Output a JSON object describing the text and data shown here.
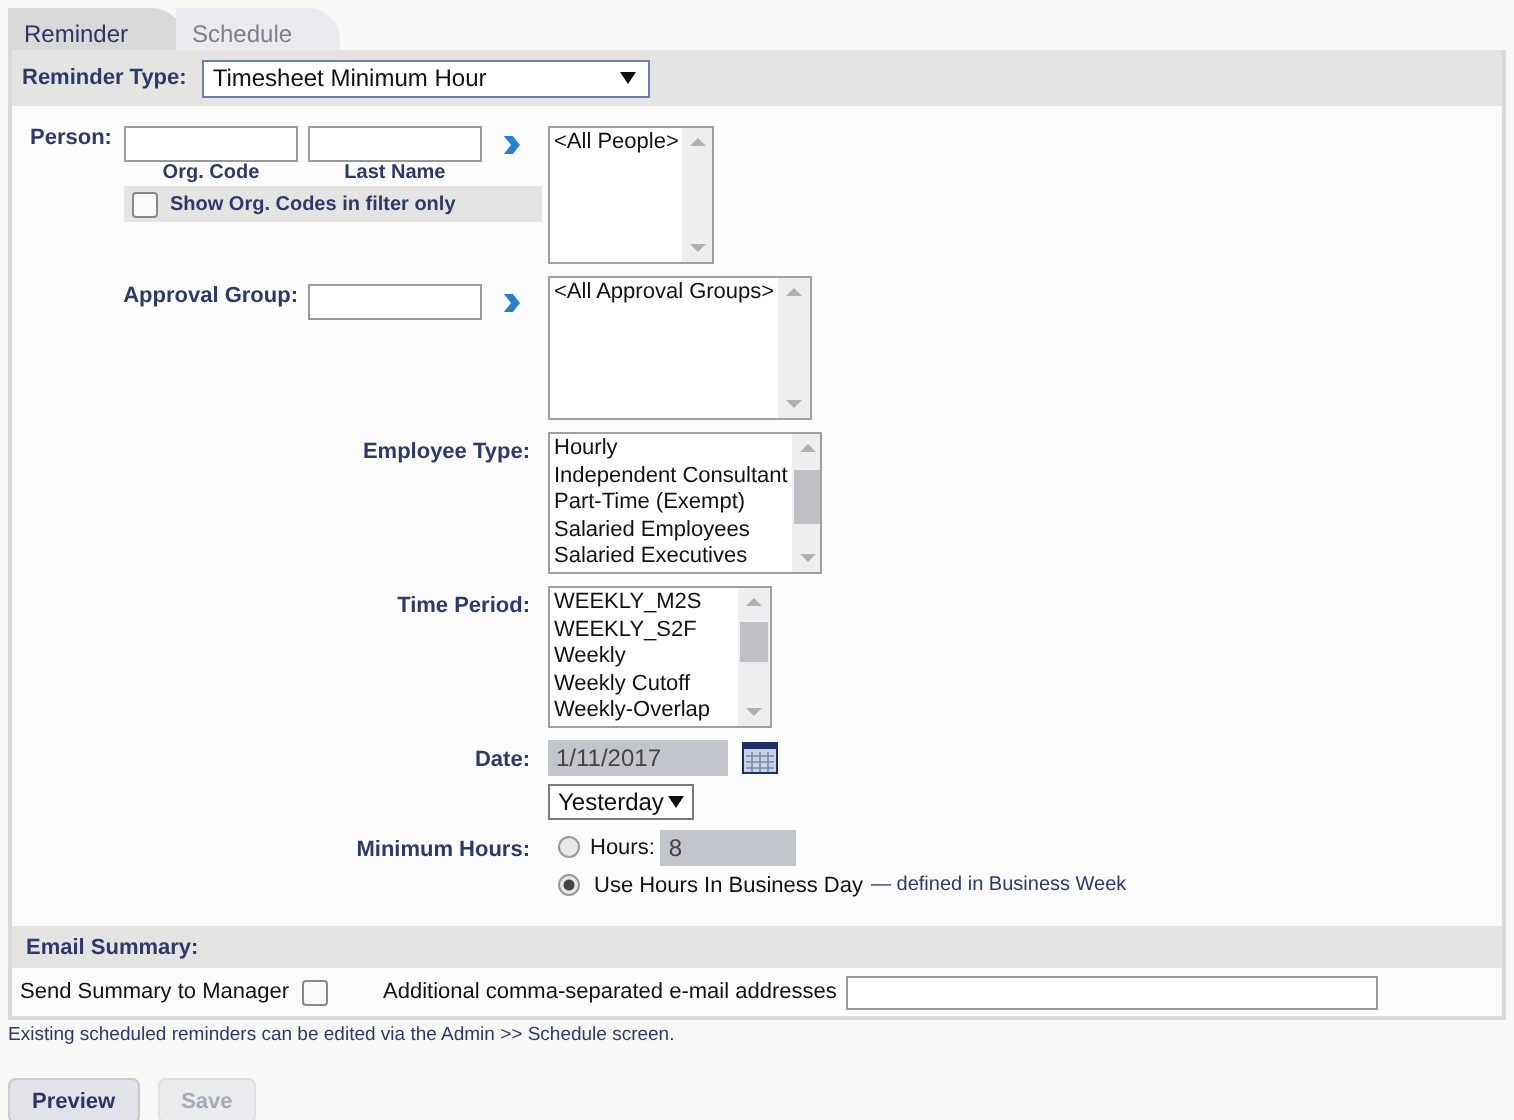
{
  "tabs": [
    {
      "label": "Reminder",
      "selected": true
    },
    {
      "label": "Schedule",
      "selected": false
    }
  ],
  "reminder_type": {
    "label": "Reminder Type:",
    "value": "Timesheet Minimum Hour"
  },
  "person": {
    "label": "Person:",
    "org_code_label": "Org. Code",
    "last_name_label": "Last Name",
    "show_org_codes": {
      "label": "Show Org. Codes in filter only",
      "checked": false
    },
    "options": [
      "<All People>"
    ]
  },
  "approval_group": {
    "label": "Approval Group:",
    "options": [
      "<All Approval Groups>"
    ]
  },
  "employee_type": {
    "label": "Employee Type:",
    "options": [
      "Hourly",
      "Independent Consultant",
      "Part-Time (Exempt)",
      "Salaried Employees",
      "Salaried Executives"
    ]
  },
  "time_period": {
    "label": "Time Period:",
    "options": [
      "WEEKLY_M2S",
      "WEEKLY_S2F",
      "Weekly",
      "Weekly Cutoff",
      "Weekly-Overlap"
    ]
  },
  "date": {
    "label": "Date:",
    "value": "1/11/2017",
    "relative": "Yesterday"
  },
  "minimum_hours": {
    "label": "Minimum Hours:",
    "options": [
      {
        "kind": "hours",
        "label": "Hours:",
        "value": "8",
        "selected": false
      },
      {
        "kind": "business_day",
        "label": "Use Hours In Business Day",
        "note": "— defined in Business Week",
        "selected": true
      }
    ]
  },
  "email_summary": {
    "title": "Email Summary:",
    "send_to_manager": {
      "label": "Send Summary to Manager",
      "checked": false
    },
    "additional_label": "Additional comma-separated e-mail addresses"
  },
  "note": "Existing scheduled reminders can be edited via the Admin >> Schedule screen.",
  "buttons": [
    {
      "label": "Preview",
      "disabled": false
    },
    {
      "label": "Save",
      "disabled": true
    }
  ]
}
